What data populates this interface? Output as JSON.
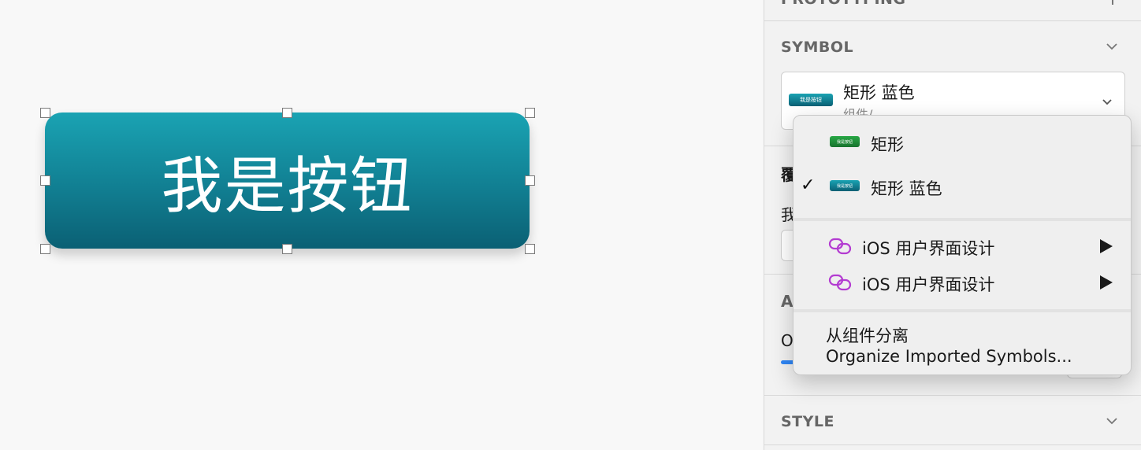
{
  "canvas": {
    "button_text": "我是按钮"
  },
  "inspector": {
    "prototyping_title": "PROTOTYPING",
    "symbol_title": "SYMBOL",
    "style_title": "STYLE",
    "selected_symbol": {
      "name": "矩形 蓝色",
      "subtitle": "组件/",
      "thumb_text": "我是按钮"
    },
    "peek": {
      "override_char": "覆",
      "text_char": "我",
      "appearance_char": "A",
      "opacity_char": "O"
    }
  },
  "menu": {
    "items": [
      {
        "label": "矩形",
        "thumb": "green",
        "thumb_text": "我是按钮",
        "checked": false
      },
      {
        "label": "矩形 蓝色",
        "thumb": "teal",
        "thumb_text": "我是按钮",
        "checked": true
      }
    ],
    "libraries": [
      {
        "label": "iOS 用户界面设计"
      },
      {
        "label": "iOS 用户界面设计"
      }
    ],
    "actions": [
      {
        "label": "从组件分离"
      },
      {
        "label": "Organize Imported Symbols..."
      }
    ],
    "check_mark": "✓"
  },
  "colors": {
    "button_top": "#1aa3b3",
    "button_bottom": "#0b6074",
    "library_icon": "#b33bd1",
    "slider_accent": "#2f86f6"
  }
}
